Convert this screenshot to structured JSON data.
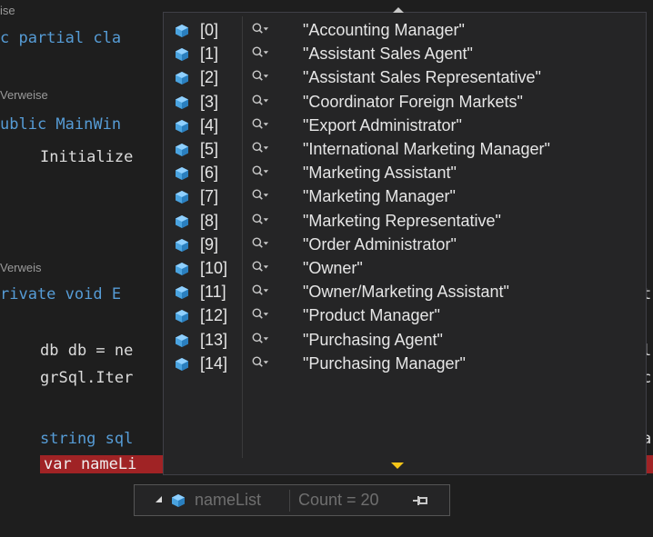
{
  "code_lines": [
    {
      "text": "ise"
    },
    {
      "text": "c partial cla"
    },
    {
      "text": "Verweise"
    },
    {
      "text": "ublic MainWin"
    },
    {
      "text": "Initialize"
    },
    {
      "text": "Verweis"
    },
    {
      "text": "rivate void E"
    },
    {
      "text": "db db = ne"
    },
    {
      "text": "grSql.Iter"
    },
    {
      "text": "string sql"
    },
    {
      "text": "var nameLi"
    }
  ],
  "right_fragments": [
    "t",
    "l",
    "c",
    "a"
  ],
  "collection_items": [
    {
      "index": "[0]",
      "value": "\"Accounting Manager\""
    },
    {
      "index": "[1]",
      "value": "\"Assistant Sales Agent\""
    },
    {
      "index": "[2]",
      "value": "\"Assistant Sales Representative\""
    },
    {
      "index": "[3]",
      "value": "\"Coordinator Foreign Markets\""
    },
    {
      "index": "[4]",
      "value": "\"Export Administrator\""
    },
    {
      "index": "[5]",
      "value": "\"International Marketing Manager\""
    },
    {
      "index": "[6]",
      "value": "\"Marketing Assistant\""
    },
    {
      "index": "[7]",
      "value": "\"Marketing Manager\""
    },
    {
      "index": "[8]",
      "value": "\"Marketing Representative\""
    },
    {
      "index": "[9]",
      "value": "\"Order Administrator\""
    },
    {
      "index": "[10]",
      "value": "\"Owner\""
    },
    {
      "index": "[11]",
      "value": "\"Owner/Marketing Assistant\""
    },
    {
      "index": "[12]",
      "value": "\"Product Manager\""
    },
    {
      "index": "[13]",
      "value": "\"Purchasing Agent\""
    },
    {
      "index": "[14]",
      "value": "\"Purchasing Manager\""
    }
  ],
  "datatip": {
    "name": "nameList",
    "count": "Count = 20"
  },
  "colors": {
    "cube": "#4aa3df",
    "keyword": "#569cd6",
    "highlight": "#a02325",
    "scroll_arrow": "#f5c518"
  }
}
